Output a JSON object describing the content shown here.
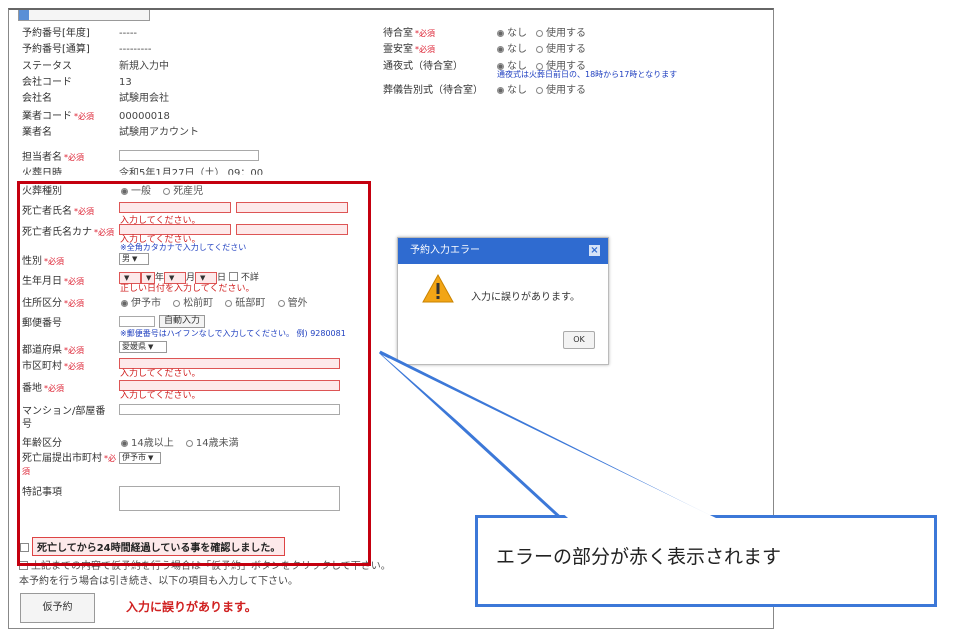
{
  "required_tag": "*必須",
  "left_fields": [
    {
      "label": "予約番号[年度]",
      "value": "-----",
      "required": false
    },
    {
      "label": "予約番号[通算]",
      "value": "---------",
      "required": false
    },
    {
      "label": "ステータス",
      "value": "新規入力中",
      "required": false
    },
    {
      "label": "会社コード",
      "value": "13",
      "required": false
    },
    {
      "label": "会社名",
      "value": "試験用会社",
      "required": false
    },
    {
      "label": "業者コード",
      "value": "00000018",
      "required": true
    },
    {
      "label": "業者名",
      "value": "試験用アカウント",
      "required": false
    }
  ],
  "tantousha": {
    "label": "担当者名",
    "required": true
  },
  "kaso_nichiji": {
    "label": "火葬日時",
    "value": "令和5年1月27日（土） 09：00"
  },
  "kaso_shubetsu": {
    "label": "火葬種別",
    "options": [
      "一般",
      "死産児"
    ],
    "selected": "一般"
  },
  "shibosha_shimei": {
    "label": "死亡者氏名",
    "error": "入力してください。"
  },
  "shibosha_kana": {
    "label": "死亡者氏名カナ",
    "error": "入力してください。",
    "note": "※全角カタカナで入力してください"
  },
  "seibetsu": {
    "label": "性別",
    "value": "男"
  },
  "seinengappi": {
    "label": "生年月日",
    "year_unit": "年",
    "month_unit": "月",
    "day_unit": "日",
    "unknown_label": "不詳",
    "error": "正しい日付を入力してください。"
  },
  "jusho_kubun": {
    "label": "住所区分",
    "options": [
      "伊予市",
      "松前町",
      "砥部町",
      "管外"
    ],
    "selected": "伊予市"
  },
  "yubin": {
    "label": "郵便番号",
    "button": "自動入力",
    "note": "※郵便番号はハイフンなしで入力してください。 例) 9280081"
  },
  "todofuken": {
    "label": "都道府県",
    "value": "愛媛県"
  },
  "shikuchoson": {
    "label": "市区町村",
    "error": "入力してください。"
  },
  "banchi": {
    "label": "番地",
    "error": "入力してください。"
  },
  "mansion": {
    "label": "マンション/部屋番号"
  },
  "nenrei_kubun": {
    "label": "年齢区分",
    "options": [
      "14歳以上",
      "14歳未満"
    ],
    "selected": "14歳以上"
  },
  "shibotodoke": {
    "label": "死亡届提出市町村",
    "value": "伊予市"
  },
  "tokki": {
    "label": "特記事項"
  },
  "right_fields": [
    {
      "label": "待合室",
      "required": true,
      "options": [
        "なし",
        "使用する"
      ],
      "selected": "なし"
    },
    {
      "label": "霊安室",
      "required": true,
      "options": [
        "なし",
        "使用する"
      ],
      "selected": "なし"
    },
    {
      "label": "通夜式（待合室）",
      "required": false,
      "options": [
        "なし",
        "使用する"
      ],
      "selected": "なし",
      "note": "通夜式は火葬日前日の、18時から17時となります"
    },
    {
      "label": "葬儀告別式（待合室）",
      "required": false,
      "options": [
        "なし",
        "使用する"
      ],
      "selected": "なし"
    }
  ],
  "confirm_checkbox": "死亡してから24時間経過している事を確認しました。",
  "instruction_1": "上記までの内容で仮予約を行う場合は「仮予約」ボタンをクリックして下さい。",
  "instruction_2": "本予約を行う場合は引き続き、以下の項目も入力して下さい。",
  "kariyoyaku_button": "仮予約",
  "bottom_error": "入力に誤りがあります。",
  "dialog": {
    "title": "予約入力エラー",
    "message": "入力に誤りがあります。",
    "ok": "OK",
    "close": "×"
  },
  "callout": "エラーの部分が赤く表示されます",
  "colors": {
    "error_red": "#c4000f",
    "dialog_blue": "#2f6bd0",
    "callout_border": "#3c78d8",
    "note_blue": "#2040c0"
  }
}
